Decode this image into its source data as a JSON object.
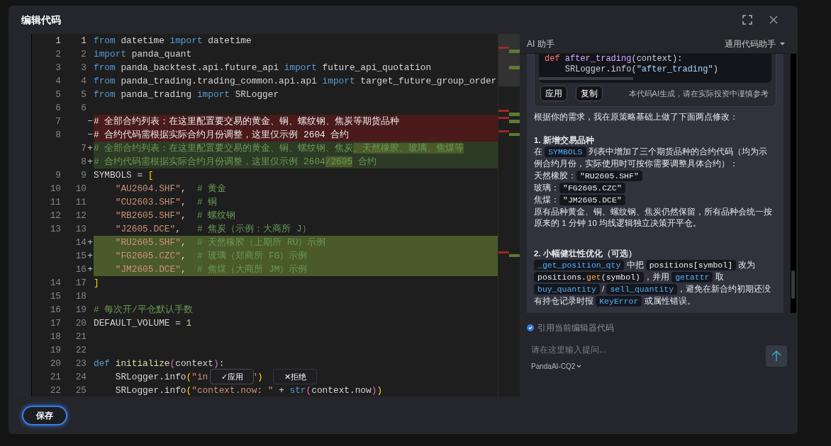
{
  "dialog": {
    "title": "编辑代码"
  },
  "editor": {
    "rows": [
      {
        "old": "1",
        "new": "1",
        "kind": "context",
        "tokens": [
          {
            "text": "from",
            "kind": "kw"
          },
          {
            "text": " datetime ",
            "kind": "id"
          },
          {
            "text": "import",
            "kind": "kw"
          },
          {
            "text": " datetime",
            "kind": "id"
          }
        ]
      },
      {
        "old": "2",
        "new": "2",
        "kind": "context",
        "tokens": [
          {
            "text": "import",
            "kind": "kw"
          },
          {
            "text": " panda_quant",
            "kind": "id"
          }
        ]
      },
      {
        "old": "3",
        "new": "3",
        "kind": "context",
        "tokens": [
          {
            "text": "from",
            "kind": "kw"
          },
          {
            "text": " panda_backtest.api.future_api ",
            "kind": "id"
          },
          {
            "text": "import",
            "kind": "kw"
          },
          {
            "text": " future_api_quotation",
            "kind": "id"
          }
        ]
      },
      {
        "old": "4",
        "new": "4",
        "kind": "context",
        "tokens": [
          {
            "text": "from",
            "kind": "kw"
          },
          {
            "text": " panda_trading.trading_common.api.api ",
            "kind": "id"
          },
          {
            "text": "import",
            "kind": "kw"
          },
          {
            "text": " target_future_group_order",
            "kind": "id"
          }
        ]
      },
      {
        "old": "5",
        "new": "5",
        "kind": "context",
        "tokens": [
          {
            "text": "from",
            "kind": "kw"
          },
          {
            "text": " panda_trading ",
            "kind": "id"
          },
          {
            "text": "import",
            "kind": "kw"
          },
          {
            "text": " SRLogger",
            "kind": "id"
          }
        ]
      },
      {
        "old": "6",
        "new": "6",
        "kind": "context",
        "tokens": []
      },
      {
        "old": "7",
        "marker": "−",
        "kind": "removed",
        "tokens": [
          {
            "text": "# 全部合约列表：在这里配置要交易的黄金、铜、螺纹钢、焦炭等期货品种",
            "kind": "txt"
          }
        ]
      },
      {
        "old": "8",
        "marker": "−",
        "kind": "removed",
        "tokens": [
          {
            "text": "# 合约代码需根据实际合约月份调整，这里仅示例 2604 合约",
            "kind": "txt"
          }
        ]
      },
      {
        "new": "7",
        "marker": "+",
        "kind": "added",
        "tokens": [
          {
            "text": "# 全部合约列表：在这里配置要交易的黄金、铜、螺纹钢、焦炭",
            "kind": "com"
          },
          {
            "text": "、天然橡胶、玻璃、焦煤等",
            "kind": "com",
            "changed": true
          }
        ]
      },
      {
        "new": "8",
        "marker": "+",
        "kind": "added",
        "tokens": [
          {
            "text": "# 合约代码需根据实际合约月份调整，这里仅示例 2604",
            "kind": "com"
          },
          {
            "text": "/2605",
            "kind": "com",
            "changed": true
          },
          {
            "text": " 合约",
            "kind": "com"
          }
        ]
      },
      {
        "old": "9",
        "new": "9",
        "kind": "context",
        "tokens": [
          {
            "text": "SYMBOLS = ",
            "kind": "id"
          },
          {
            "text": "[",
            "kind": "br"
          }
        ]
      },
      {
        "old": "10",
        "new": "10",
        "kind": "context",
        "indented": true,
        "tokens": [
          {
            "text": "\"AU2604.SHF\"",
            "kind": "str"
          },
          {
            "text": ",  ",
            "kind": "id"
          },
          {
            "text": "# 黄金",
            "kind": "com"
          }
        ]
      },
      {
        "old": "11",
        "new": "11",
        "kind": "context",
        "indented": true,
        "tokens": [
          {
            "text": "\"CU2603.SHF\"",
            "kind": "str"
          },
          {
            "text": ",  ",
            "kind": "id"
          },
          {
            "text": "# 铜",
            "kind": "com"
          }
        ]
      },
      {
        "old": "12",
        "new": "12",
        "kind": "context",
        "indented": true,
        "tokens": [
          {
            "text": "\"RB2605.SHF\"",
            "kind": "str"
          },
          {
            "text": ",  ",
            "kind": "id"
          },
          {
            "text": "# 螺纹钢",
            "kind": "com"
          }
        ]
      },
      {
        "old": "13",
        "new": "13",
        "kind": "context",
        "indented": true,
        "tokens": [
          {
            "text": "\"J2605.DCE\"",
            "kind": "str"
          },
          {
            "text": ",   ",
            "kind": "id"
          },
          {
            "text": "# 焦炭（示例：大商所 J）",
            "kind": "com"
          }
        ]
      },
      {
        "new": "14",
        "marker": "+",
        "kind": "inserted",
        "indented": true,
        "tokens": [
          {
            "text": "\"RU2605.SHF\"",
            "kind": "str"
          },
          {
            "text": ",  ",
            "kind": "id"
          },
          {
            "text": "# 天然橡胶（上期所 RU）示例",
            "kind": "com"
          }
        ]
      },
      {
        "new": "15",
        "marker": "+",
        "kind": "inserted",
        "indented": true,
        "tokens": [
          {
            "text": "\"FG2605.CZC\"",
            "kind": "str"
          },
          {
            "text": ",  ",
            "kind": "id"
          },
          {
            "text": "# 玻璃（郑商所 FG）示例",
            "kind": "com"
          }
        ]
      },
      {
        "new": "16",
        "marker": "+",
        "kind": "inserted",
        "indented": true,
        "tokens": [
          {
            "text": "\"JM2605.DCE\"",
            "kind": "str"
          },
          {
            "text": ",  ",
            "kind": "id"
          },
          {
            "text": "# 焦煤（大商所 JM）示例",
            "kind": "com"
          }
        ]
      },
      {
        "old": "14",
        "new": "17",
        "kind": "context",
        "tokens": [
          {
            "text": "]",
            "kind": "br"
          }
        ]
      },
      {
        "old": "15",
        "new": "18",
        "kind": "context",
        "tokens": []
      },
      {
        "old": "16",
        "new": "19",
        "kind": "context",
        "tokens": [
          {
            "text": "# 每次开/平仓默认手数",
            "kind": "com"
          }
        ]
      },
      {
        "old": "17",
        "new": "20",
        "kind": "context",
        "tokens": [
          {
            "text": "DEFAULT_VOLUME = ",
            "kind": "id"
          },
          {
            "text": "1",
            "kind": "num"
          }
        ]
      },
      {
        "old": "18",
        "new": "21",
        "kind": "context",
        "tokens": []
      },
      {
        "old": "19",
        "new": "22",
        "kind": "context",
        "tokens": []
      },
      {
        "old": "20",
        "new": "23",
        "kind": "context",
        "tokens": [
          {
            "text": "def",
            "kind": "kw"
          },
          {
            "text": " initialize",
            "kind": "fn"
          },
          {
            "text": "(",
            "kind": "pr"
          },
          {
            "text": "context",
            "kind": "id"
          },
          {
            "text": ")",
            "kind": "pr"
          },
          {
            "text": ":",
            "kind": "id"
          }
        ]
      },
      {
        "old": "21",
        "new": "24",
        "kind": "context",
        "indented": true,
        "tokens": [
          {
            "text": "SRLogger.info",
            "kind": "id"
          },
          {
            "text": "(",
            "kind": "br"
          },
          {
            "text": "\"in",
            "kind": "str"
          }
        ],
        "actions": [
          {
            "kind": "accept",
            "mark": "✓",
            "label": "应用"
          },
          {
            "kind": "reject",
            "mark": "✕",
            "label": "拒绝"
          }
        ],
        "tokens_after": [
          {
            "text": "\"",
            "kind": "str"
          },
          {
            "text": ")",
            "kind": "br"
          }
        ]
      },
      {
        "old": "22",
        "new": "25",
        "kind": "context",
        "indented": true,
        "tokens": [
          {
            "text": "SRLogger.info",
            "kind": "id"
          },
          {
            "text": "(",
            "kind": "br"
          },
          {
            "text": "\"context.now: \"",
            "kind": "str"
          },
          {
            "text": " + ",
            "kind": "id"
          },
          {
            "text": "str",
            "kind": "kw"
          },
          {
            "text": "(",
            "kind": "pr"
          },
          {
            "text": "context.now",
            "kind": "id"
          },
          {
            "text": ")",
            "kind": "pr"
          },
          {
            "text": ")",
            "kind": "br"
          }
        ]
      }
    ]
  },
  "assistant": {
    "title": "AI 助手",
    "mode": "通用代码助手",
    "code_card": {
      "lines": [
        {
          "indented": false,
          "tokens": [
            {
              "text": "def",
              "kind": "kw"
            },
            {
              "text": " after_trading",
              "kind": "fn"
            },
            {
              "text": "(context):",
              "kind": "id"
            }
          ]
        },
        {
          "indented": true,
          "tokens": [
            {
              "text": "SRLogger.info(",
              "kind": "id"
            },
            {
              "text": "\"after_trading\"",
              "kind": "str"
            },
            {
              "text": ")",
              "kind": "id"
            }
          ]
        }
      ],
      "buttons": [
        "应用",
        "复制"
      ],
      "note": "本代码AI生成，请在实际投资中谨慎参考"
    },
    "message": [
      {
        "kind": "paragraph",
        "segments": [
          {
            "text": "根据你的需求，我在原策略基础上做了下面两点修改："
          }
        ]
      },
      {
        "kind": "heading",
        "segments": [
          {
            "text": "1. 新增交易品种"
          }
        ]
      },
      {
        "kind": "line",
        "segments": [
          {
            "text": "在 "
          },
          {
            "code": [
              {
                "text": "SYMBOLS",
                "kind": "name"
              }
            ]
          },
          {
            "text": " 列表中增加了三个期货品种的合约代码（均为示例合约月份，实际使用时可按你需要调整具体合约）："
          }
        ]
      },
      {
        "kind": "line",
        "segments": [
          {
            "text": "天然橡胶："
          },
          {
            "code": [
              {
                "text": "\"RU2605.SHF\"",
                "kind": "plain"
              }
            ]
          }
        ]
      },
      {
        "kind": "line",
        "segments": [
          {
            "text": "玻璃："
          },
          {
            "code": [
              {
                "text": "\"FG2605.CZC\"",
                "kind": "plain"
              }
            ]
          }
        ]
      },
      {
        "kind": "line",
        "segments": [
          {
            "text": "焦煤："
          },
          {
            "code": [
              {
                "text": "\"JM2605.DCE\"",
                "kind": "plain"
              }
            ]
          }
        ]
      },
      {
        "kind": "paragraph_end",
        "segments": [
          {
            "text": "原有品种黄金、铜、螺纹钢、焦炭仍然保留，所有品种会统一按原来的 1 分钟 10 均线逻辑独立决策开平仓。"
          }
        ]
      },
      {
        "kind": "heading",
        "segments": [
          {
            "text": "2. 小幅健壮性优化（可选）"
          }
        ]
      },
      {
        "kind": "line",
        "segments": [
          {
            "code": [
              {
                "text": "_get_position_qty",
                "kind": "name"
              }
            ]
          },
          {
            "text": " 中把 "
          },
          {
            "code": [
              {
                "text": "positions[symbol]",
                "kind": "plain"
              }
            ]
          },
          {
            "text": " 改为 "
          },
          {
            "code": [
              {
                "text": "positions.",
                "kind": "plain"
              },
              {
                "text": "get",
                "kind": "fn"
              },
              {
                "text": "(symbol)",
                "kind": "plain"
              }
            ]
          },
          {
            "text": "，并用 "
          },
          {
            "code": [
              {
                "text": "getattr",
                "kind": "name"
              }
            ]
          },
          {
            "text": " 取 "
          },
          {
            "code": [
              {
                "text": "buy_quantity",
                "kind": "name"
              }
            ]
          },
          {
            "text": " / "
          },
          {
            "code": [
              {
                "text": "sell_quantity",
                "kind": "name"
              }
            ]
          },
          {
            "text": "，避免在新合约初期还没有持仓记录时报 "
          },
          {
            "code": [
              {
                "text": "KeyError",
                "kind": "name"
              }
            ]
          },
          {
            "text": " 或属性错误。"
          }
        ]
      }
    ],
    "reference": {
      "label": "引用当前编辑器代码",
      "checked": true
    },
    "input": {
      "placeholder": "请在这里输入提问..."
    },
    "model": "PandaAI-CQ2"
  },
  "footer": {
    "save": "保存"
  }
}
